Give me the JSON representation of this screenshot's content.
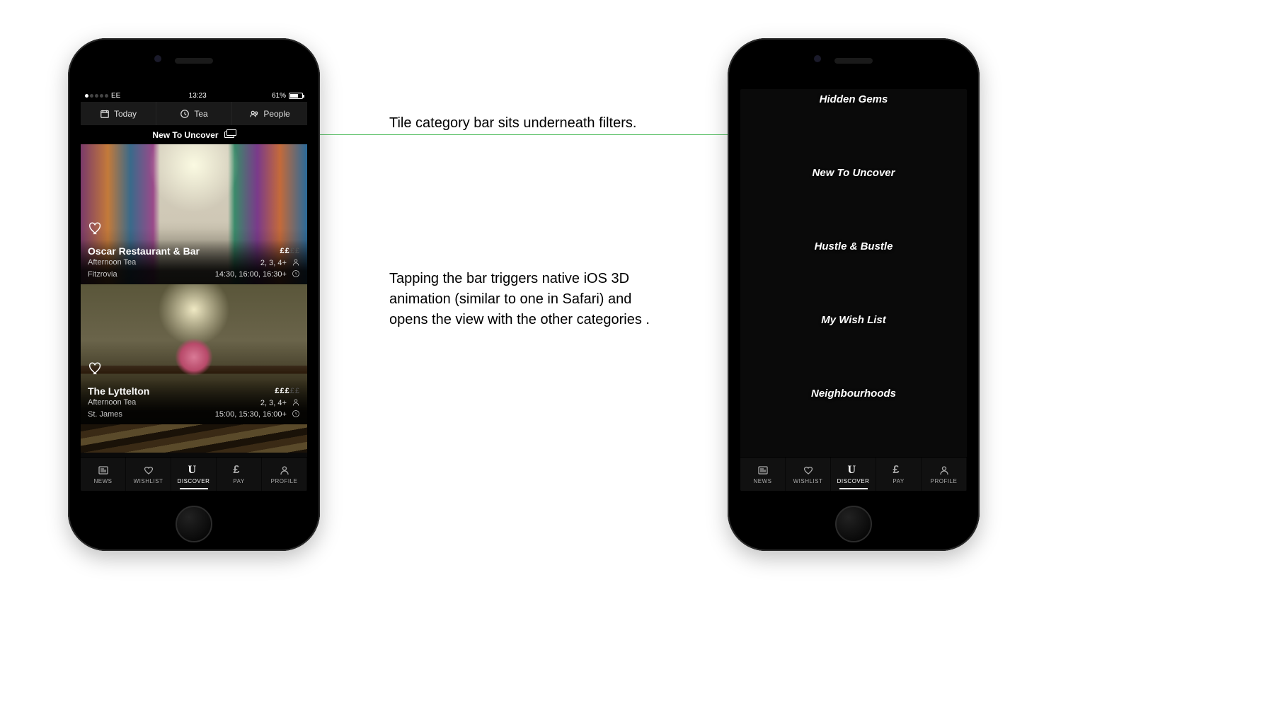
{
  "annotations": {
    "a1": "Tile category bar sits underneath filters.",
    "a2": "Tapping the bar triggers native iOS 3D animation (similar to one in Safari) and opens the view with the other categories ."
  },
  "statusbar": {
    "carrier": "EE",
    "time": "13:23",
    "battery_pct": "61%"
  },
  "filters": {
    "today": "Today",
    "meal": "Tea",
    "people": "People"
  },
  "category_bar": {
    "label": "New To Uncover"
  },
  "cards": [
    {
      "name": "Oscar Restaurant & Bar",
      "meal": "Afternoon Tea",
      "area": "Fitzrovia",
      "price_active": "££",
      "price_dim": "££",
      "party": "2, 3, 4+",
      "times": "14:30, 16:00, 16:30+"
    },
    {
      "name": "The Lyttelton",
      "meal": "Afternoon Tea",
      "area": "St. James",
      "price_active": "£££",
      "price_dim": "££",
      "party": "2, 3, 4+",
      "times": "15:00, 15:30, 16:00+"
    }
  ],
  "tabs": {
    "news": "NEWS",
    "wishlist": "WISHLIST",
    "discover": "DISCOVER",
    "pay": "PAY",
    "profile": "PROFILE"
  },
  "tiles": [
    "Hidden Gems",
    "New To Uncover",
    "Hustle & Bustle",
    "My Wish List",
    "Neighbourhoods"
  ]
}
